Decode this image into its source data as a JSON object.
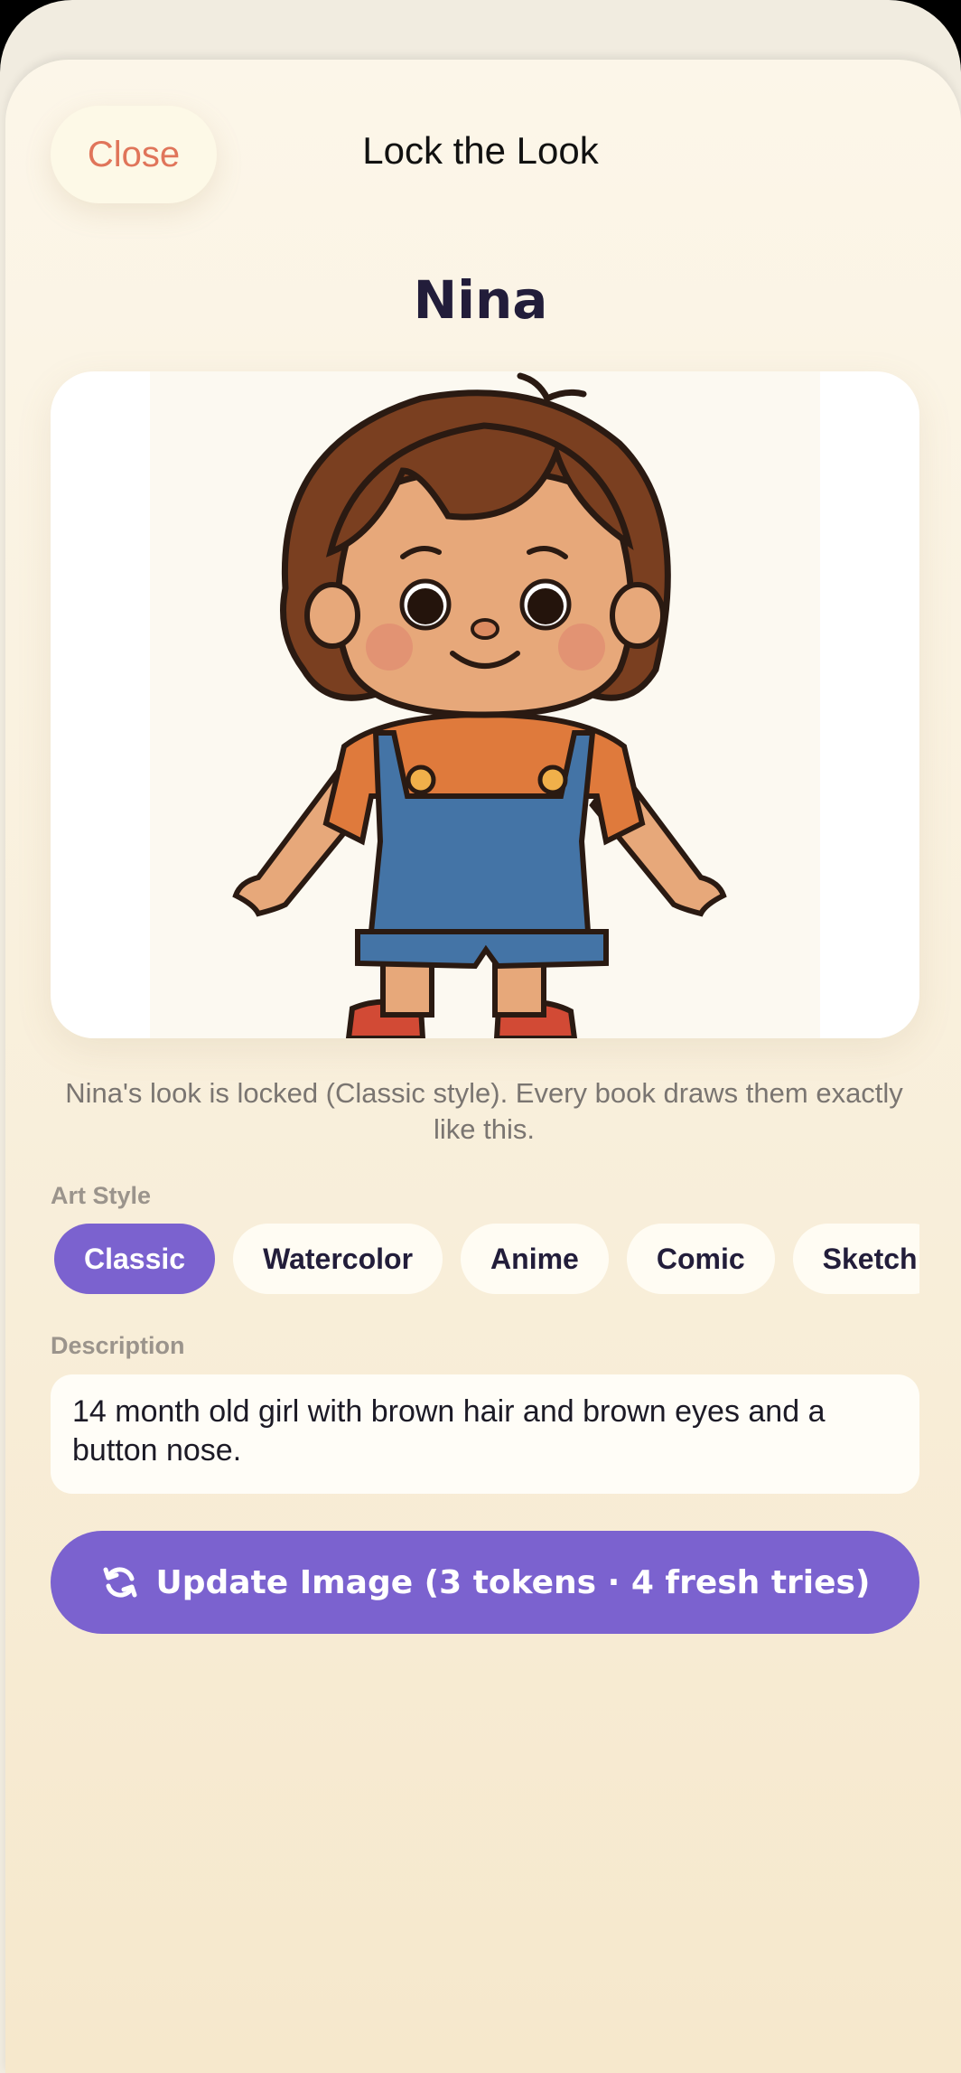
{
  "header": {
    "close_label": "Close",
    "title": "Lock the Look"
  },
  "character": {
    "name": "Nina",
    "image_icon": "character-portrait",
    "locked_note": "Nina's look is locked (Classic style). Every book draws them exactly like this."
  },
  "art_style": {
    "label": "Art Style",
    "options": [
      "Classic",
      "Watercolor",
      "Anime",
      "Comic",
      "Sketch"
    ],
    "selected": "Classic"
  },
  "description": {
    "label": "Description",
    "value": "14 month old girl with brown hair and brown eyes and a button nose."
  },
  "update_button": {
    "label": "Update Image (3 tokens · 4 fresh tries)",
    "icon": "refresh-icon"
  },
  "colors": {
    "accent": "#7b62cf",
    "close_text": "#e0755a",
    "background": "#fcf6e9"
  }
}
